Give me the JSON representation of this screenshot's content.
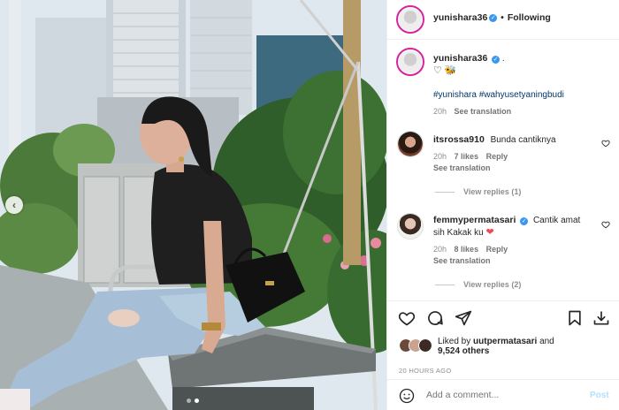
{
  "header": {
    "username": "yunishara36",
    "separator": "•",
    "follow_label": "Following"
  },
  "caption": {
    "username": "yunishara36",
    "trailing": ".",
    "emoji_line": "♡ 🐝",
    "hashtags": "#yunishara #wahyusetyaningbudi",
    "time": "20h",
    "see_translation": "See translation"
  },
  "comments": [
    {
      "username": "itsrossa910",
      "text": "Bunda cantiknya",
      "time": "20h",
      "likes": "7 likes",
      "reply": "Reply",
      "see_translation": "See translation",
      "view_replies": "View replies (1)"
    },
    {
      "username": "femmypermatasari",
      "text_line1": "Cantik amat",
      "text_line2": "sih Kakak ku",
      "emoji": "❤",
      "time": "20h",
      "likes": "8 likes",
      "reply": "Reply",
      "see_translation": "See translation",
      "view_replies": "View replies (2)"
    }
  ],
  "likes": {
    "prefix": "Liked by",
    "user": "uutpermatasari",
    "and": "and",
    "others": "9,524 others"
  },
  "timestamp": "20 HOURS AGO",
  "comment_box": {
    "placeholder": "Add a comment...",
    "post_label": "Post"
  },
  "carousel": {
    "prev_glyph": "‹",
    "current_slide": 2,
    "total_slides": 2
  },
  "colors": {
    "link_blue": "#00376b",
    "verified_blue": "#3897f0",
    "post_disabled": "#b2dffc",
    "heart_red": "#ed4956"
  },
  "icons": [
    "heart-icon",
    "comment-icon",
    "share-icon",
    "bookmark-icon",
    "download-icon",
    "emoji-icon",
    "verified-icon"
  ]
}
